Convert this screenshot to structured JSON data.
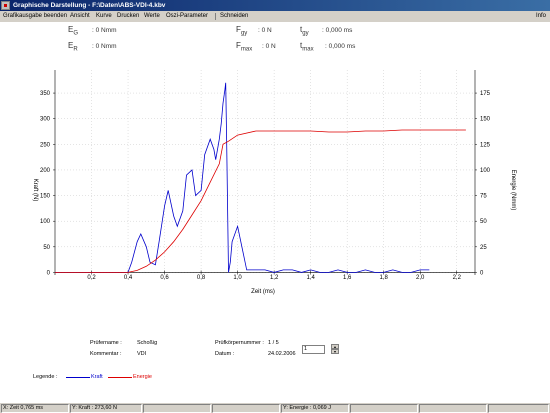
{
  "window": {
    "title": "Graphische Darstellung - F:\\Daten\\ABS-VDI-4.kbv"
  },
  "menu": {
    "items": [
      "Grafikausgabe beenden",
      "Ansicht",
      "Kurve",
      "Drucken",
      "Werte",
      "Oszi-Parameter",
      "Schneiden"
    ],
    "info": "Info"
  },
  "values": {
    "eg_label": "E",
    "eg_sub": "G",
    "eg_value": ": 0 Nmm",
    "er_label": "E",
    "er_sub": "R",
    "er_value": ": 0 Nmm",
    "fgy_label": "F",
    "fgy_sub": "gy",
    "fgy_value": ": 0 N",
    "fmax_label": "F",
    "fmax_sub": "max",
    "fmax_value": ": 0 N",
    "tgy_label": "t",
    "tgy_sub": "gy",
    "tgy_value": ": 0,000 ms",
    "tmax_label": "t",
    "tmax_sub": "max",
    "tmax_value": ": 0,000 ms"
  },
  "chart_data": {
    "type": "line",
    "xlabel": "Zeit (ms)",
    "ylabel": "Kraft (N)",
    "y2label": "Energie (Nmm)",
    "xlim": [
      0,
      2.3
    ],
    "ylim": [
      -5,
      395
    ],
    "y2lim": [
      -2.5,
      197.5
    ],
    "x_ticks": [
      "0,2",
      "0,4",
      "0,6",
      "0,8",
      "1,0",
      "1,2",
      "1,4",
      "1,6",
      "1,8",
      "2,0",
      "2,2"
    ],
    "x_tick_values": [
      0.2,
      0.4,
      0.6,
      0.8,
      1.0,
      1.2,
      1.4,
      1.6,
      1.8,
      2.0,
      2.2
    ],
    "y_ticks": [
      "0",
      "50",
      "100",
      "150",
      "200",
      "250",
      "300",
      "350"
    ],
    "y_tick_values": [
      0,
      50,
      100,
      150,
      200,
      250,
      300,
      350
    ],
    "y2_ticks": [
      "0",
      "25",
      "50",
      "75",
      "100",
      "125",
      "150",
      "175"
    ],
    "y2_tick_values": [
      0,
      25,
      50,
      75,
      100,
      125,
      150,
      175
    ],
    "grid": true,
    "series": [
      {
        "name": "Kraft",
        "color": "#0000cc",
        "axis": "left",
        "x": [
          0,
          0.3,
          0.4,
          0.42,
          0.45,
          0.47,
          0.5,
          0.52,
          0.55,
          0.57,
          0.6,
          0.62,
          0.65,
          0.67,
          0.7,
          0.72,
          0.75,
          0.77,
          0.8,
          0.82,
          0.85,
          0.87,
          0.88,
          0.9,
          0.91,
          0.92,
          0.93,
          0.935,
          0.94,
          0.95,
          0.96,
          0.97,
          1.0,
          1.05,
          1.1,
          1.15,
          1.2,
          1.25,
          1.3,
          1.35,
          1.4,
          1.45,
          1.5,
          1.55,
          1.6,
          1.65,
          1.7,
          1.75,
          1.8,
          1.85,
          1.9,
          1.95,
          2.0,
          2.03,
          2.05
        ],
        "y": [
          0,
          0,
          0,
          20,
          60,
          75,
          50,
          20,
          15,
          60,
          130,
          160,
          110,
          90,
          120,
          190,
          200,
          150,
          160,
          230,
          260,
          240,
          220,
          260,
          290,
          330,
          355,
          370,
          250,
          0,
          20,
          60,
          90,
          5,
          5,
          5,
          0,
          5,
          5,
          0,
          5,
          0,
          0,
          5,
          0,
          0,
          5,
          0,
          0,
          5,
          0,
          0,
          5,
          5,
          5
        ]
      },
      {
        "name": "Energie",
        "color": "#dd0000",
        "axis": "right",
        "x": [
          0,
          0.1,
          0.2,
          0.3,
          0.4,
          0.45,
          0.5,
          0.55,
          0.6,
          0.65,
          0.7,
          0.75,
          0.8,
          0.85,
          0.9,
          0.92,
          0.95,
          1.0,
          1.1,
          1.2,
          1.3,
          1.4,
          1.5,
          1.6,
          1.7,
          1.8,
          1.9,
          2.0,
          2.1,
          2.2,
          2.25
        ],
        "y": [
          0,
          0,
          0,
          0,
          0,
          2,
          6,
          12,
          20,
          30,
          42,
          56,
          70,
          88,
          106,
          125,
          128,
          134,
          138,
          138,
          138,
          138,
          137,
          137,
          138,
          138,
          139,
          139,
          139,
          139,
          139
        ]
      }
    ]
  },
  "legend": {
    "label": "Legende :",
    "kraft": "Kraft",
    "energie": "Energie",
    "kraft_color": "#0000cc",
    "energie_color": "#dd0000"
  },
  "info": {
    "pruefername_label": "Prüfername :",
    "pruefername_value": "Schoßig",
    "kommentar_label": "Kommentar :",
    "kommentar_value": "VDI",
    "pk_label": "Prüfkörpernummer :",
    "pk_value": "1 / 5",
    "datum_label": "Datum :",
    "datum_value": "24.02.2006",
    "spin_value": "1"
  },
  "status": {
    "x_zeit": "X: Zeit  0,765 ms",
    "y_kraft": "Y: Kraft : 273,60 N",
    "y_energie": "Y: Energie : 0,069 J"
  }
}
